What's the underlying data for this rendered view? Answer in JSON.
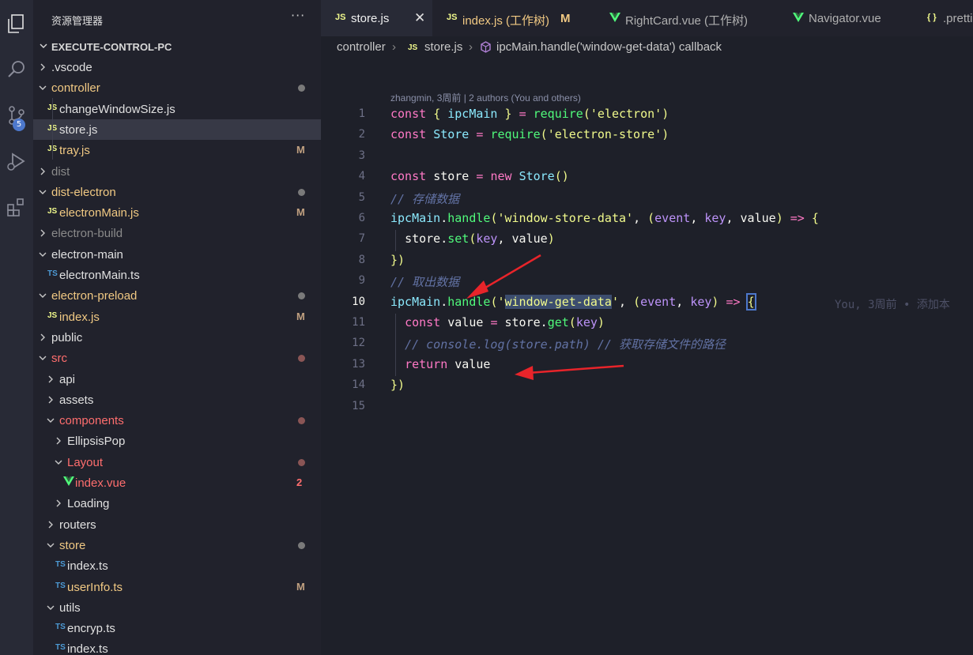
{
  "activity": {
    "scm_badge": "5"
  },
  "sidebar": {
    "title": "资源管理器",
    "more": "···",
    "root": "EXECUTE-CONTROL-PC",
    "items": [
      {
        "name": ".vscode",
        "type": "folder",
        "open": false,
        "indent": 0,
        "color": "#e0e0e0"
      },
      {
        "name": "controller",
        "type": "folder",
        "open": true,
        "indent": 0,
        "color": "#f1c983",
        "dot": "#7a7a7a"
      },
      {
        "name": "changeWindowSize.js",
        "type": "js",
        "indent": 1,
        "color": "#e0e0e0"
      },
      {
        "name": "store.js",
        "type": "js",
        "indent": 1,
        "color": "#e0e0e0",
        "active": true
      },
      {
        "name": "tray.js",
        "type": "js",
        "indent": 1,
        "color": "#f1c983",
        "status": "M"
      },
      {
        "name": "dist",
        "type": "folder",
        "open": false,
        "indent": 0,
        "color": "#8a8a8a"
      },
      {
        "name": "dist-electron",
        "type": "folder",
        "open": true,
        "indent": 0,
        "color": "#f1c983",
        "dot": "#7a7a7a"
      },
      {
        "name": "electronMain.js",
        "type": "js",
        "indent": 1,
        "color": "#f1c983",
        "status": "M"
      },
      {
        "name": "electron-build",
        "type": "folder",
        "open": false,
        "indent": 0,
        "color": "#8a8a8a"
      },
      {
        "name": "electron-main",
        "type": "folder",
        "open": true,
        "indent": 0,
        "color": "#e0e0e0"
      },
      {
        "name": "electronMain.ts",
        "type": "ts",
        "indent": 1,
        "color": "#e0e0e0"
      },
      {
        "name": "electron-preload",
        "type": "folder",
        "open": true,
        "indent": 0,
        "color": "#f1c983",
        "dot": "#7a7a7a"
      },
      {
        "name": "index.js",
        "type": "js",
        "indent": 1,
        "color": "#f1c983",
        "status": "M"
      },
      {
        "name": "public",
        "type": "folder",
        "open": false,
        "indent": 0,
        "color": "#e0e0e0"
      },
      {
        "name": "src",
        "type": "folder",
        "open": true,
        "indent": 0,
        "color": "#ff6e6e",
        "dot": "#8a5555"
      },
      {
        "name": "api",
        "type": "folder",
        "open": false,
        "indent": 1,
        "color": "#e0e0e0"
      },
      {
        "name": "assets",
        "type": "folder",
        "open": false,
        "indent": 1,
        "color": "#e0e0e0"
      },
      {
        "name": "components",
        "type": "folder",
        "open": true,
        "indent": 1,
        "color": "#ff6e6e",
        "dot": "#8a5555"
      },
      {
        "name": "EllipsisPop",
        "type": "folder",
        "open": false,
        "indent": 2,
        "color": "#e0e0e0"
      },
      {
        "name": "Layout",
        "type": "folder",
        "open": true,
        "indent": 2,
        "color": "#ff6e6e",
        "dot": "#8a5555"
      },
      {
        "name": "index.vue",
        "type": "vue",
        "indent": 3,
        "color": "#ff6e6e",
        "status": "2",
        "status_color": "#ff6e6e"
      },
      {
        "name": "Loading",
        "type": "folder",
        "open": false,
        "indent": 2,
        "color": "#e0e0e0"
      },
      {
        "name": "routers",
        "type": "folder",
        "open": false,
        "indent": 1,
        "color": "#e0e0e0"
      },
      {
        "name": "store",
        "type": "folder",
        "open": true,
        "indent": 1,
        "color": "#f1c983",
        "dot": "#7a7a7a"
      },
      {
        "name": "index.ts",
        "type": "ts",
        "indent": 2,
        "color": "#e0e0e0"
      },
      {
        "name": "userInfo.ts",
        "type": "ts",
        "indent": 2,
        "color": "#f1c983",
        "status": "M"
      },
      {
        "name": "utils",
        "type": "folder",
        "open": true,
        "indent": 1,
        "color": "#e0e0e0"
      },
      {
        "name": "encryp.ts",
        "type": "ts",
        "indent": 2,
        "color": "#e0e0e0"
      },
      {
        "name": "index.ts",
        "type": "ts",
        "indent": 2,
        "color": "#e0e0e0"
      }
    ]
  },
  "tabs": [
    {
      "label": "store.js",
      "type": "js",
      "active": true,
      "close": "✕"
    },
    {
      "label": "index.js (工作树)",
      "type": "js",
      "mod": "M"
    },
    {
      "label": "RightCard.vue (工作树)",
      "type": "vue"
    },
    {
      "label": "Navigator.vue",
      "type": "vue"
    },
    {
      "label": ".pretti",
      "type": "json"
    }
  ],
  "icons": {
    "js": "JS",
    "ts": "TS",
    "json": "{ }"
  },
  "breadcrumb": {
    "folder": "controller",
    "sep": "›",
    "file": "store.js",
    "symbol": "ipcMain.handle('window-get-data') callback"
  },
  "codelens": "zhangmin, 3周前 | 2 authors (You and others)",
  "editor": {
    "current_line": 10,
    "blame_inline": "You, 3周前 • 添加本",
    "line_numbers": [
      "1",
      "2",
      "3",
      "4",
      "5",
      "6",
      "7",
      "8",
      "9",
      "10",
      "11",
      "12",
      "13",
      "14",
      "15"
    ],
    "lines": [
      "const { ipcMain } = require('electron')",
      "const Store = require('electron-store')",
      "",
      "const store = new Store()",
      "// 存储数据",
      "ipcMain.handle('window-store-data', (event, key, value) => {",
      "  store.set(key, value)",
      "})",
      "// 取出数据",
      "ipcMain.handle('window-get-data', (event, key) => {",
      "  const value = store.get(key)",
      "  // console.log(store.path) // 获取存储文件的路径",
      "  return value",
      "})",
      ""
    ]
  },
  "annotations": {
    "arrow_color": "#e8242a"
  }
}
